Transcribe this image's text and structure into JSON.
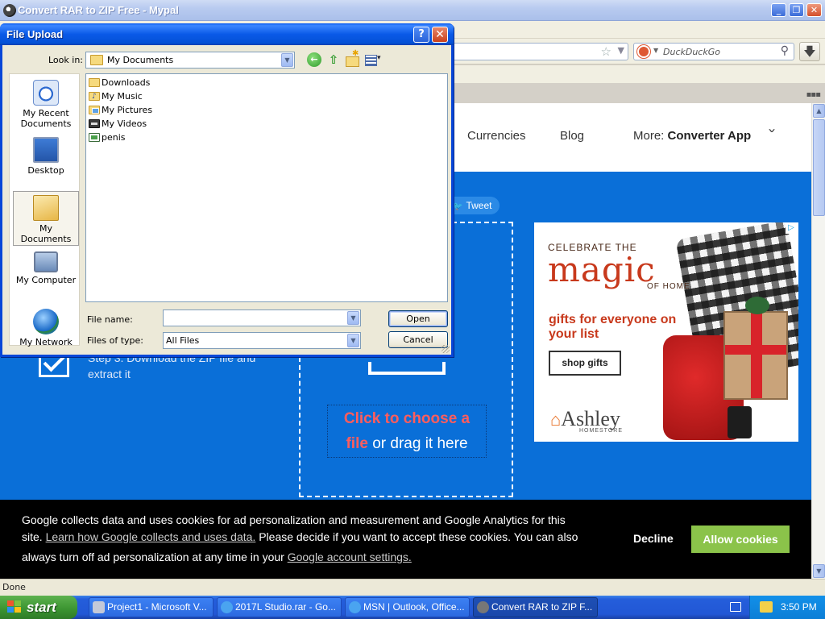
{
  "browser": {
    "title": "Convert RAR to ZIP Free - Mypal",
    "search_placeholder": "DuckDuckGo",
    "status": "Done"
  },
  "site": {
    "nav": [
      "Currencies",
      "Blog"
    ],
    "more_label": "More:",
    "more_value": "Converter App",
    "tweet": "Tweet",
    "choose_red": "Click to choose a file",
    "choose_red_1": "Click to choose a",
    "choose_red_2": "file",
    "choose_rest": "or drag it here",
    "step3": "Step 3. Download the ZIP file and extract it"
  },
  "ad": {
    "celebrate": "CELEBRATE THE",
    "magic": "magic",
    "of_home": "OF HOME",
    "gifts": "gifts for everyone on your list",
    "shop": "shop gifts",
    "brand": "Ashley",
    "brand_sub": "HOMESTORE"
  },
  "cookie": {
    "line1": "Google collects data and uses cookies for ad personalization and measurement and Google Analytics for this",
    "line2_pre": "site.",
    "line2_link": "Learn how Google collects and uses data.",
    "line2_post": "Please decide if you want to accept these cookies. You can also",
    "line3_pre": "always turn off ad personalization at any time in your",
    "line3_link": "Google account settings.",
    "decline": "Decline",
    "allow": "Allow cookies"
  },
  "dialog": {
    "title": "File Upload",
    "look_in_label": "Look in:",
    "look_in_value": "My Documents",
    "places": [
      "My Recent Documents",
      "Desktop",
      "My Documents",
      "My Computer",
      "My Network"
    ],
    "files": [
      "Downloads",
      "My Music",
      "My Pictures",
      "My Videos",
      "penis"
    ],
    "file_name_label": "File name:",
    "file_name_value": "",
    "file_type_label": "Files of type:",
    "file_type_value": "All Files",
    "open": "Open",
    "cancel": "Cancel",
    "help": "?",
    "close": "✕"
  },
  "taskbar": {
    "start": "start",
    "tasks": [
      "Project1 - Microsoft V...",
      "2017L Studio.rar - Go...",
      "MSN | Outlook, Office...",
      "Convert RAR to ZIP F..."
    ],
    "clock": "3:50 PM"
  }
}
